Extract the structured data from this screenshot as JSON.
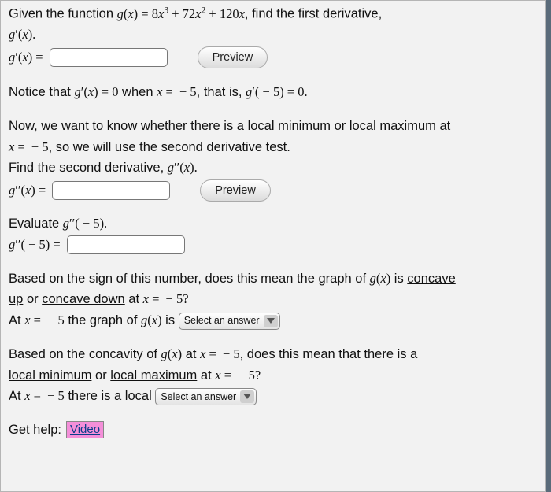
{
  "intro": {
    "line1_pre": "Given the function ",
    "line1_math": "g(x) = 8x³ + 72x² + 120x",
    "line1_post": ", find the first derivative,",
    "line2_math": "g′(x).",
    "eq_label": "g′(x) = ",
    "preview": "Preview"
  },
  "notice": {
    "pre": "Notice that ",
    "m1": "g′(x) = 0",
    "mid1": " when ",
    "m2": "x = − 5",
    "mid2": ", that is, ",
    "m3": "g′( − 5) = 0."
  },
  "second": {
    "p1": "Now, we want to know whether there is a local minimum or local maximum at",
    "p2a": "x = − 5",
    "p2b": ", so we will use the second derivative test.",
    "p3a": "Find the second derivative, ",
    "p3b": "g′′(x).",
    "eq_label": "g′′(x) = ",
    "preview": "Preview"
  },
  "evaluate": {
    "p1a": "Evaluate ",
    "p1b": "g′′( − 5).",
    "eq_label": "g′′( − 5) = "
  },
  "concavity": {
    "p1a": "Based on the sign of this number, does this mean the graph of ",
    "p1b": "g(x)",
    "p1c": " is ",
    "u1": "concave",
    "u2": "up",
    "mid_or": " or ",
    "u3": "concave down",
    "p1d": " at ",
    "m1": "x = − 5?",
    "p2a": "At ",
    "m2": "x = − 5",
    "p2b": " the graph of ",
    "m3": "g(x)",
    "p2c": " is ",
    "select": "Select an answer"
  },
  "local": {
    "p1a": "Based on the concavity of ",
    "p1b": "g(x)",
    "p1c": " at ",
    "m1": "x = − 5",
    "p1d": ", does this mean that there is a",
    "u1": "local minimum",
    "mid_or": " or ",
    "u2": "local maximum",
    "p2a": " at ",
    "m2": "x = − 5?",
    "p3a": "At ",
    "m3": "x = − 5",
    "p3b": " there is a local ",
    "select": "Select an answer"
  },
  "help": {
    "label": "Get help:",
    "video": "Video"
  }
}
